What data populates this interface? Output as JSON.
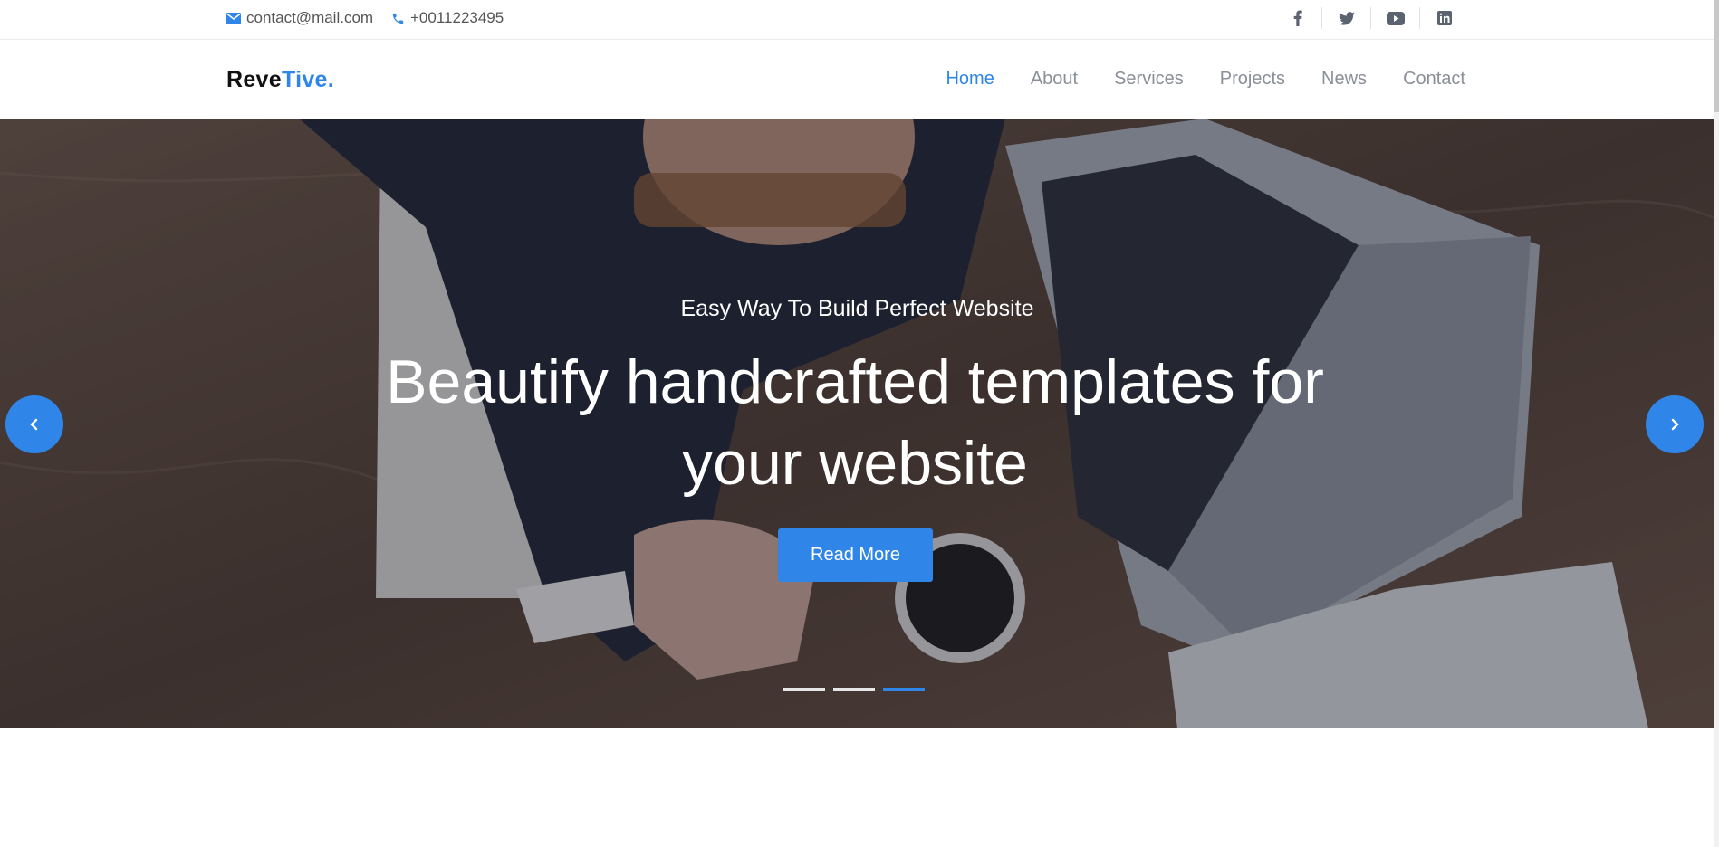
{
  "topbar": {
    "email": "contact@mail.com",
    "phone": "+0011223495",
    "socials": [
      "facebook-icon",
      "twitter-icon",
      "youtube-icon",
      "linkedin-icon"
    ]
  },
  "navbar": {
    "logo_part1": "Reve",
    "logo_part2": "Tive.",
    "menu": [
      "Home",
      "About",
      "Services",
      "Projects",
      "News",
      "Contact"
    ],
    "active": "Home"
  },
  "hero": {
    "subtitle": "Easy Way To Build Perfect Website",
    "title": "Beautify handcrafted templates for your website",
    "button_label": "Read More",
    "slides_count": 3,
    "active_slide": 3
  },
  "colors": {
    "accent": "#2f86e8",
    "nav_text": "#8a8f98"
  }
}
